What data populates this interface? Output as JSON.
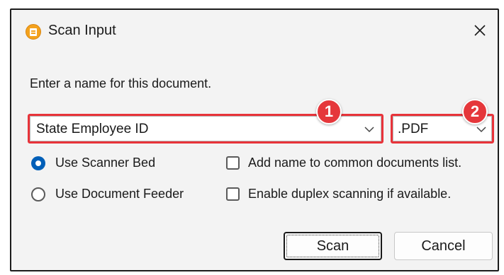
{
  "dialog": {
    "title": "Scan Input",
    "prompt": "Enter a name for this document.",
    "name_value": "State Employee ID",
    "format_value": ".PDF"
  },
  "annotations": {
    "badge_1": "1",
    "badge_2": "2",
    "color": "#e5373b"
  },
  "options": {
    "scanner_bed": "Use Scanner Bed",
    "document_feeder": "Use Document Feeder",
    "selected": "Use Scanner Bed",
    "add_common": "Add name to common documents list.",
    "add_common_checked": false,
    "duplex": "Enable duplex scanning if available.",
    "duplex_checked": false
  },
  "buttons": {
    "scan": "Scan",
    "cancel": "Cancel"
  },
  "colors": {
    "accent": "#005fb8",
    "window_bg": "#f3f3f3",
    "app_icon": "#f4a21d"
  },
  "icons": {
    "app": "scanner-app-icon",
    "close": "close-icon",
    "dropdown": "chevron-down-icon"
  }
}
